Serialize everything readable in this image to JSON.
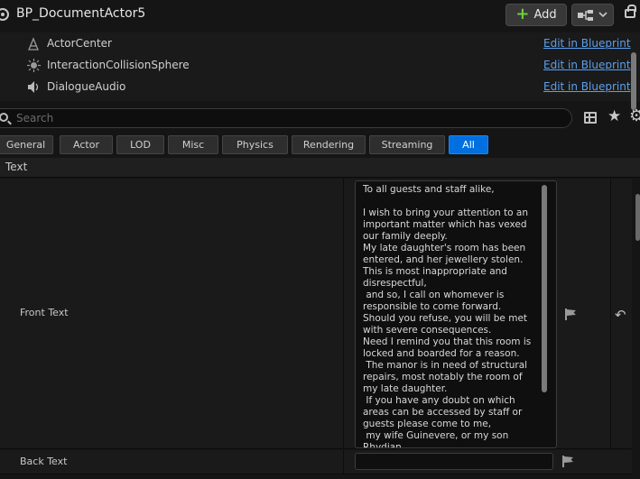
{
  "header": {
    "title": "BP_DocumentActor5",
    "add_label": "Add"
  },
  "components": [
    {
      "icon": "actor-center-icon",
      "label": "ActorCenter",
      "link": "Edit in Blueprint"
    },
    {
      "icon": "collision-sphere-icon",
      "label": "InteractionCollisionSphere",
      "link": "Edit in Blueprint"
    },
    {
      "icon": "speaker-icon",
      "label": "DialogueAudio",
      "link": "Edit in Blueprint"
    }
  ],
  "search": {
    "placeholder": "Search",
    "value": ""
  },
  "filters": [
    "General",
    "Actor",
    "LOD",
    "Misc",
    "Physics",
    "Rendering",
    "Streaming",
    "All"
  ],
  "active_filter": "All",
  "section": {
    "title": "Text"
  },
  "properties": {
    "front_text_label": "Front Text",
    "front_text_value": "To all guests and staff alike,\n\nI wish to bring your attention to an important matter which has vexed our family deeply.\nMy late daughter's room has been entered, and her jewellery stolen.\nThis is most inappropriate and disrespectful,\n and so, I call on whomever is responsible to come forward.\nShould you refuse, you will be met with severe consequences.\nNeed I remind you that this room is locked and boarded for a reason.\n The manor is in need of structural repairs, most notably the room of my late daughter.\n If you have any doubt on which areas can be accessed by staff or guests please come to me,\n my wife Guinevere, or my son Rhydian.",
    "back_text_label": "Back Text",
    "back_text_value": ""
  },
  "colors": {
    "accent": "#0070e0",
    "link": "#5aa0f0",
    "add_plus": "#6fcf3a"
  }
}
